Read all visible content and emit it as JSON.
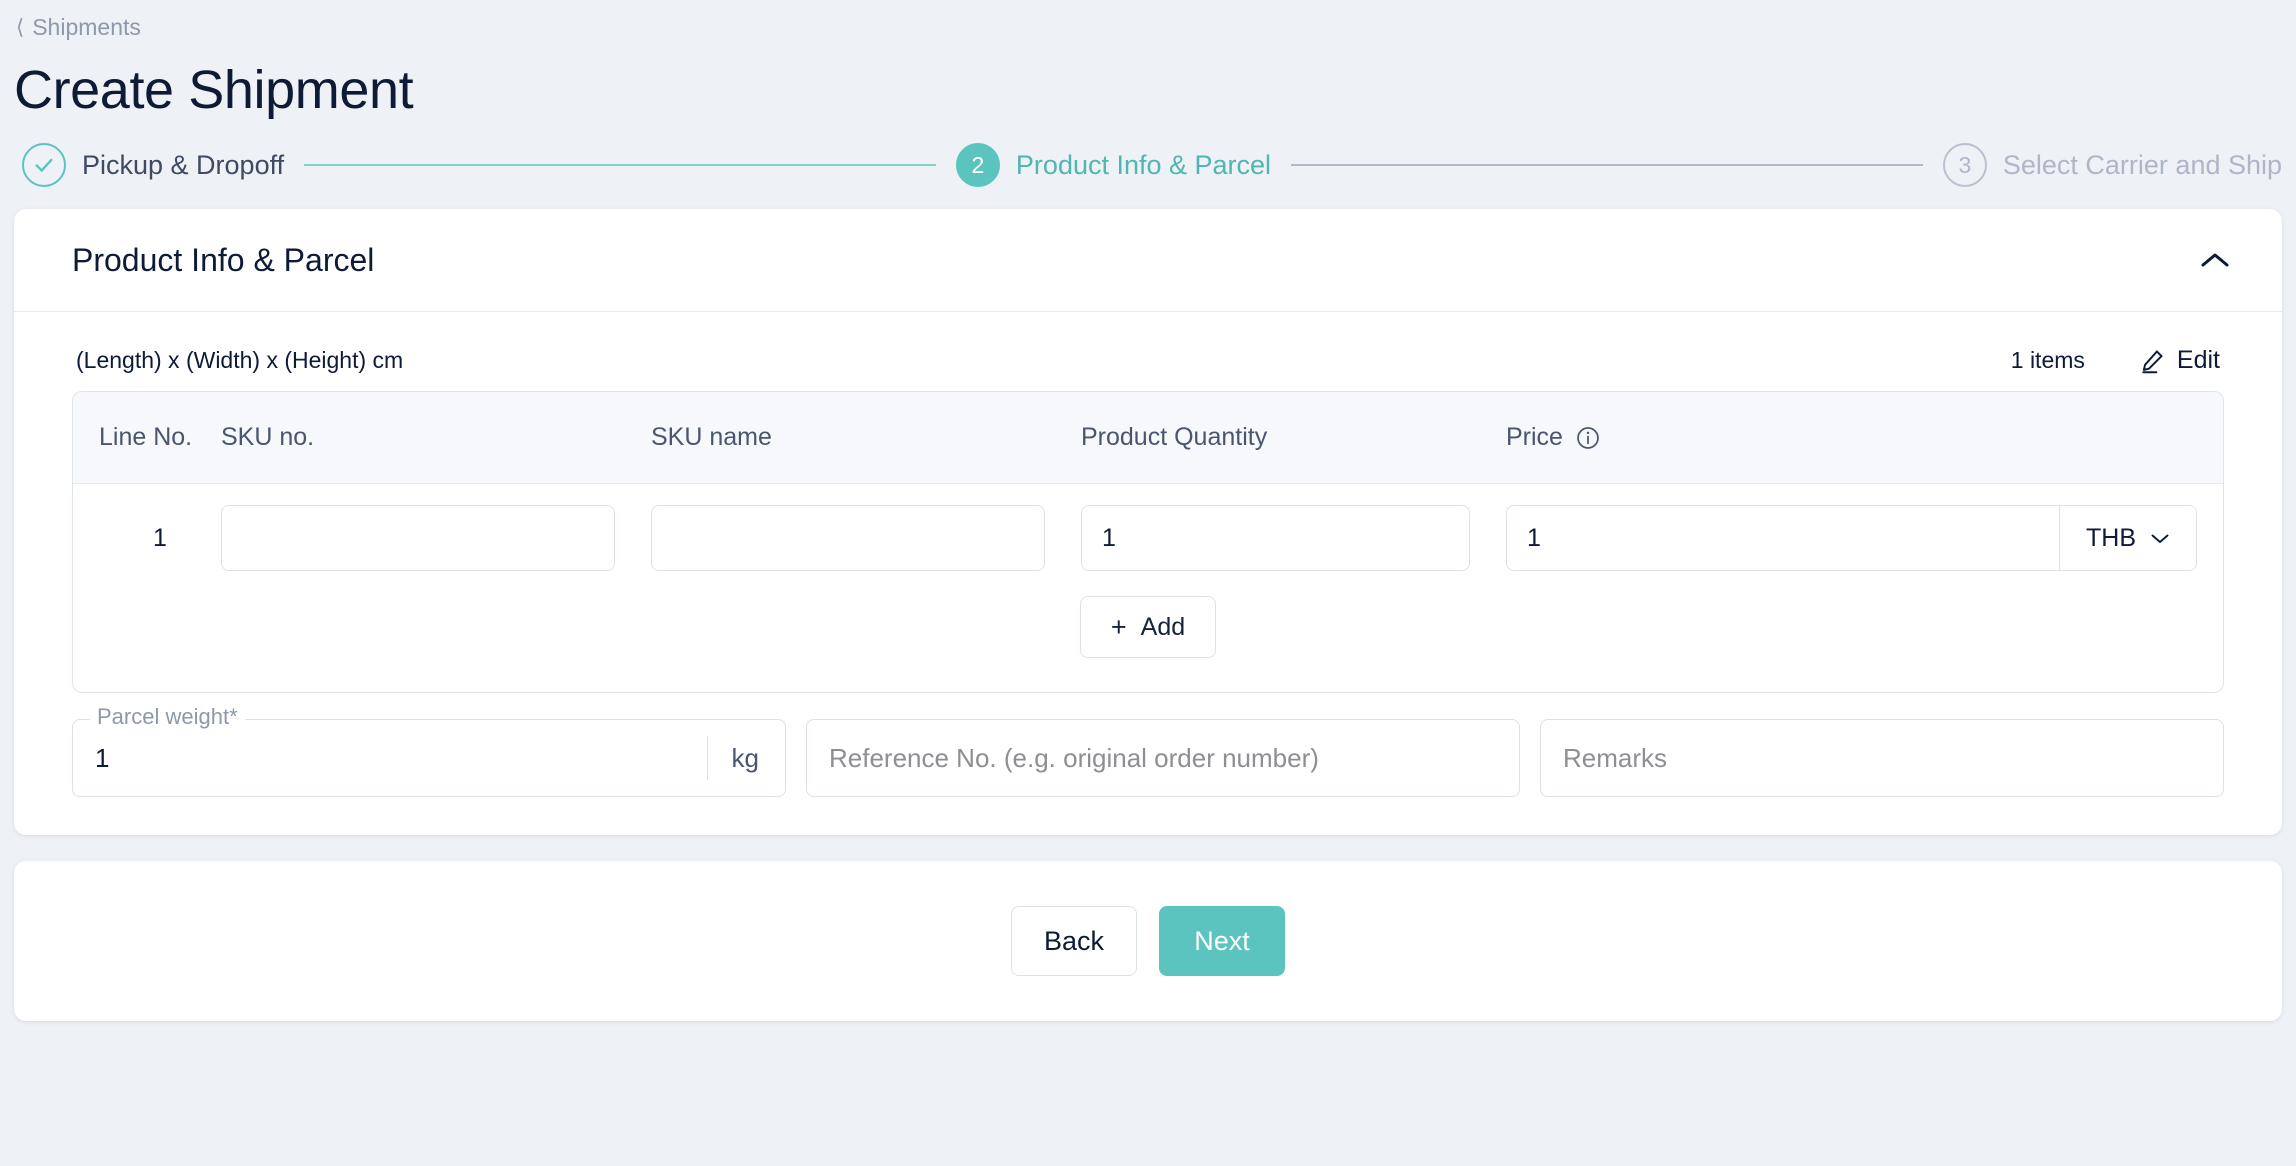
{
  "breadcrumb": {
    "label": "Shipments",
    "icon": "chevron-left-icon"
  },
  "page_title": "Create Shipment",
  "theme": {
    "accent": "#5bc4bf",
    "background": "#eef1f5",
    "text": "#0d1b36",
    "muted": "#8e98ab"
  },
  "stepper": {
    "steps": [
      {
        "marker": "✓",
        "label": "Pickup & Dropoff",
        "state": "done"
      },
      {
        "marker": "2",
        "label": "Product Info & Parcel",
        "state": "active"
      },
      {
        "marker": "3",
        "label": "Select Carrier and Ship",
        "state": "todo"
      }
    ]
  },
  "card": {
    "title": "Product Info & Parcel",
    "collapse_icon": "chevron-up-icon",
    "dimensions_label": "(Length) x (Width) x (Height) cm",
    "items_count": "1 items",
    "edit_label": "Edit",
    "edit_icon": "pencil-icon"
  },
  "table": {
    "headers": {
      "line_no": "Line No.",
      "sku_no": "SKU no.",
      "sku_name": "SKU name",
      "quantity": "Product Quantity",
      "price": "Price"
    },
    "price_info_icon": "info-icon",
    "rows": [
      {
        "line_no": "1",
        "sku_no": "",
        "sku_no_placeholder": "",
        "sku_name": "",
        "sku_name_placeholder": "",
        "quantity": "1",
        "price": "1",
        "currency": "THB",
        "currency_icon": "chevron-down-icon"
      }
    ],
    "add_label": "Add",
    "add_icon": "plus-icon"
  },
  "fields": {
    "weight": {
      "label": "Parcel weight",
      "required_mark": "*",
      "value": "1",
      "suffix": "kg"
    },
    "reference": {
      "value": "",
      "placeholder": "Reference No. (e.g. original order number)"
    },
    "remarks": {
      "value": "",
      "placeholder": "Remarks"
    }
  },
  "footer": {
    "back_label": "Back",
    "next_label": "Next"
  }
}
